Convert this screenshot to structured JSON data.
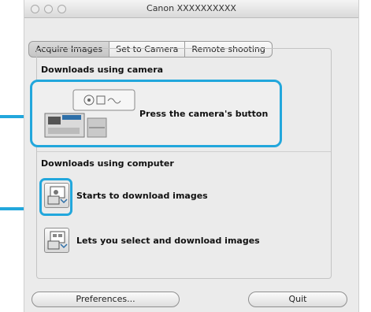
{
  "window": {
    "title": "Canon XXXXXXXXXX"
  },
  "tabs": [
    "Acquire Images",
    "Set to Camera",
    "Remote shooting"
  ],
  "camera_section": {
    "title": "Downloads using camera",
    "action_label": "Press the camera's button"
  },
  "computer_section": {
    "title": "Downloads using computer",
    "items": [
      {
        "label": "Starts to download images"
      },
      {
        "label": "Lets you select and download images"
      }
    ]
  },
  "buttons": {
    "preferences": "Preferences...",
    "quit": "Quit"
  },
  "colors": {
    "highlight": "#22a7dc"
  }
}
